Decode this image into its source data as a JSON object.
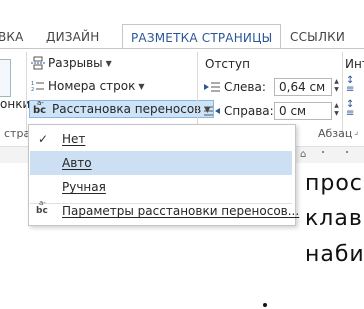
{
  "tabs": [
    {
      "label": "ВКА"
    },
    {
      "label": "ДИЗАЙН"
    },
    {
      "label": "РАЗМЕТКА СТРАНИЦЫ"
    },
    {
      "label": "ССЫЛКИ"
    }
  ],
  "ribbon": {
    "left_cut_label": "онки",
    "breaks_label": "Разрывы",
    "line_numbers_label": "Номера строк",
    "hyphenation_label": "Расстановка переносов",
    "indent_title": "Отступ",
    "spacing_title_cut": "Инт",
    "left_label": "Слева:",
    "left_value": "0,64 см",
    "right_label": "Справа:",
    "right_value": "0 см",
    "group_labels": {
      "page_setup_cut": "стра",
      "paragraph": "Абзац"
    },
    "hyphen_icon_text": "bc",
    "hyphen_icon_sup": "a-"
  },
  "hyphenation_menu": {
    "items": [
      {
        "label": "Нет",
        "checked": true,
        "highlighted": false
      },
      {
        "label": "Авто",
        "checked": false,
        "highlighted": true
      },
      {
        "label": "Ручная",
        "checked": false,
        "highlighted": false
      },
      {
        "label": "Параметры расстановки переносов...",
        "checked": false,
        "highlighted": false
      }
    ],
    "check_glyph": "✓"
  },
  "document": {
    "lines": [
      "прос",
      "клав",
      "наби"
    ]
  },
  "colors": {
    "accent": "#2b579a",
    "highlight": "#cde0f3"
  }
}
